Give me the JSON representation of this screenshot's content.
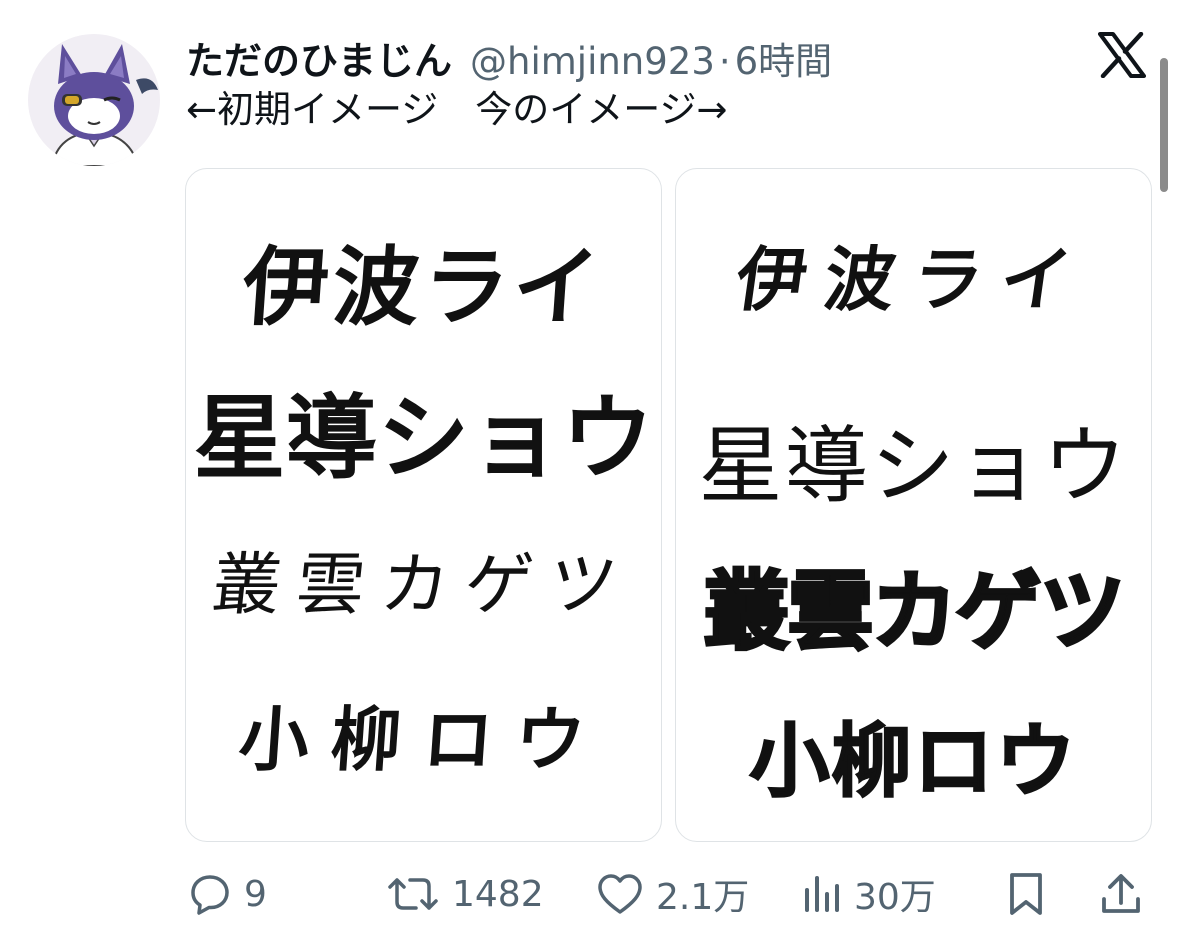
{
  "tweet": {
    "display_name": "ただのひまじん",
    "handle": "@himjinn923",
    "separator": "·",
    "time": "6時間",
    "text": "←初期イメージ　今のイメージ→"
  },
  "media": {
    "left_image": {
      "lines": [
        "伊波ライ",
        "星導ショウ",
        "叢雲カゲツ",
        "小柳ロウ"
      ]
    },
    "right_image": {
      "lines": [
        "伊波ライ",
        "星導ショウ",
        "叢雲カゲツ",
        "小柳ロウ"
      ]
    }
  },
  "actions": {
    "replies": "9",
    "reposts": "1482",
    "likes": "2.1万",
    "views": "30万"
  },
  "icons": {
    "logo": "x-logo-icon",
    "reply": "reply-icon",
    "repost": "repost-icon",
    "like": "heart-icon",
    "views": "views-chart-icon",
    "bookmark": "bookmark-icon",
    "share": "share-icon"
  },
  "colors": {
    "secondary_text": "#536471",
    "primary_text": "#0f1419",
    "card_border": "#dfe3e6"
  }
}
